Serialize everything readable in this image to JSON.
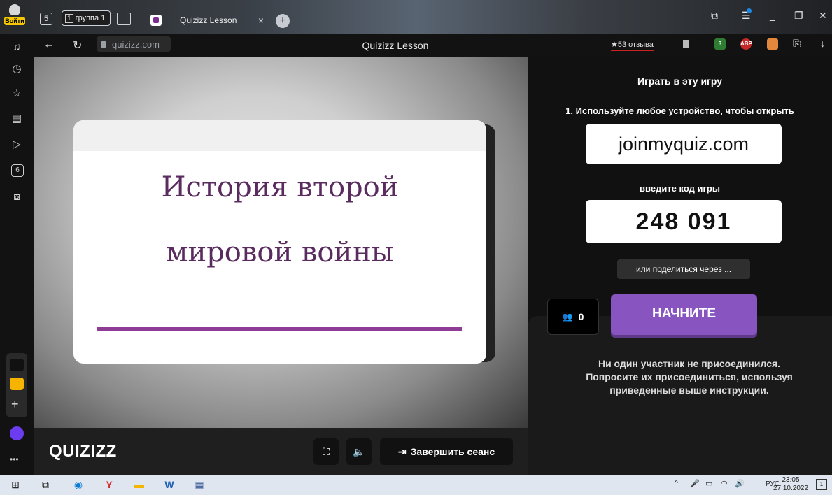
{
  "browser": {
    "signin_label": "Войти",
    "home_badge": "5",
    "tab_group_count": "1",
    "tab_group_label": "группа 1",
    "active_tab_title": "Quizizz Lesson",
    "tab_close": "×",
    "new_tab": "+",
    "url": "quizizz.com",
    "page_title": "Quizizz Lesson",
    "reviews": "★53 отзыва",
    "ext_abp": "ABP",
    "ext_badge": "3"
  },
  "sidebar": {
    "calendar_badge": "6"
  },
  "slide": {
    "title_line1": "История второй",
    "title_line2": "мировой войны",
    "accent_color": "#8e3c96",
    "title_color": "#5a2b5f"
  },
  "controls": {
    "logo": "QUIZIZZ",
    "end_session": "Завершить сеанс"
  },
  "panel": {
    "play_title": "Играть в эту игру",
    "step1": "1. Используйте любое устройство, чтобы открыть",
    "join_url": "joinmyquiz.com",
    "code_label": "введите код игры",
    "game_code": "248 091",
    "share_label": "или поделиться через ...",
    "players_count": "0",
    "start_label": "НАЧНИТЕ",
    "start_color": "#8854c0",
    "notice_line1": "Ни один участник не присоединился.",
    "notice_line2": "Попросите их присоединиться, используя",
    "notice_line3": "приведенные выше инструкции."
  },
  "taskbar": {
    "lang": "РУС",
    "time": "23:05",
    "date": "27.10.2022",
    "notification_badge": "1"
  }
}
